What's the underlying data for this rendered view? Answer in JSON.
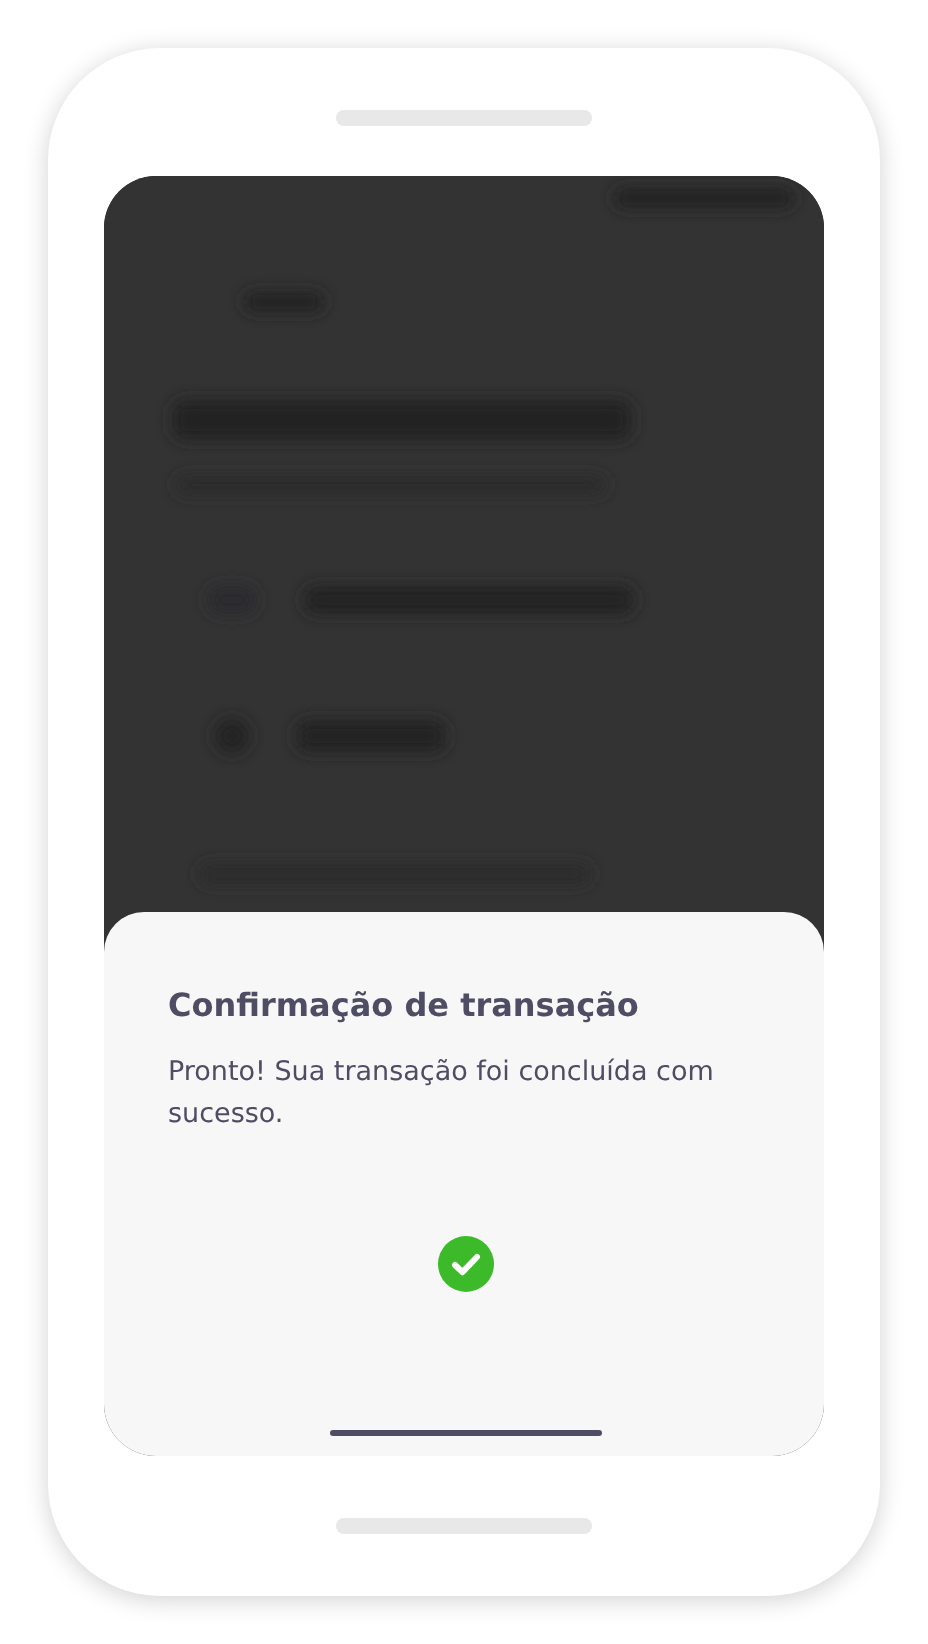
{
  "dialog": {
    "title": "Confirmação de transação",
    "message": "Pronto! Sua transação foi concluída com sucesso.",
    "succeeded": true
  }
}
